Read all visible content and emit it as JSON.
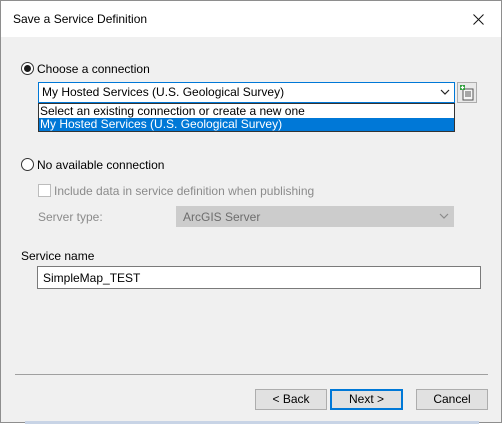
{
  "window": {
    "title": "Save a Service Definition"
  },
  "connection": {
    "choose_label": "Choose a connection",
    "selected": "My Hosted Services (U.S. Geological Survey)",
    "options": [
      "Select an existing connection or create a new one",
      "My Hosted Services (U.S. Geological Survey)"
    ],
    "none_label": "No available connection"
  },
  "publishing": {
    "include_data_label": "Include data in service definition when publishing",
    "server_type_label": "Server type:",
    "server_type_value": "ArcGIS Server"
  },
  "service": {
    "name_label": "Service name",
    "name_value": "SimpleMap_TEST"
  },
  "footer": {
    "back_label": "< Back",
    "next_label": "Next >",
    "cancel_label": "Cancel"
  },
  "icons": {
    "close": "close-icon",
    "dropdown": "chevron-down-icon",
    "add_connection": "add-connection-icon"
  },
  "colors": {
    "accent": "#0078d7",
    "selection": "#0078d7"
  }
}
